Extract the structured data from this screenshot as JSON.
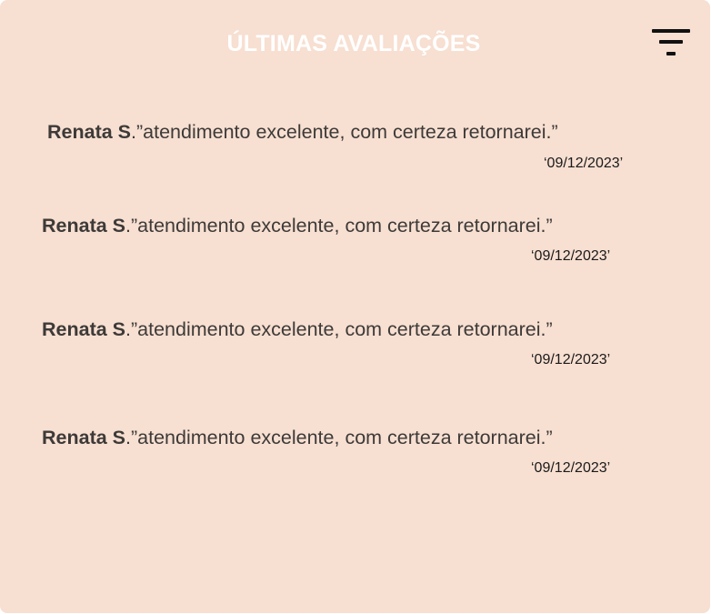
{
  "header": {
    "title": "ÚLTIMAS AVALIAÇÕES",
    "filter_icon": "filter-icon"
  },
  "reviews": [
    {
      "author": "Renata S",
      "text": ".”atendimento excelente, com certeza retornarei.”",
      "date": "‘09/12/2023’"
    },
    {
      "author": "Renata S",
      "text": ".”atendimento excelente, com certeza retornarei.”",
      "date": "‘09/12/2023’"
    },
    {
      "author": "Renata S",
      "text": ".”atendimento excelente, com certeza retornarei.”",
      "date": "‘09/12/2023’"
    },
    {
      "author": "Renata S",
      "text": ".”atendimento excelente, com certeza retornarei.”",
      "date": "‘09/12/2023’"
    }
  ],
  "colors": {
    "card_background": "#f7dfd1",
    "title": "#ffffff",
    "text": "#3d3a38"
  }
}
